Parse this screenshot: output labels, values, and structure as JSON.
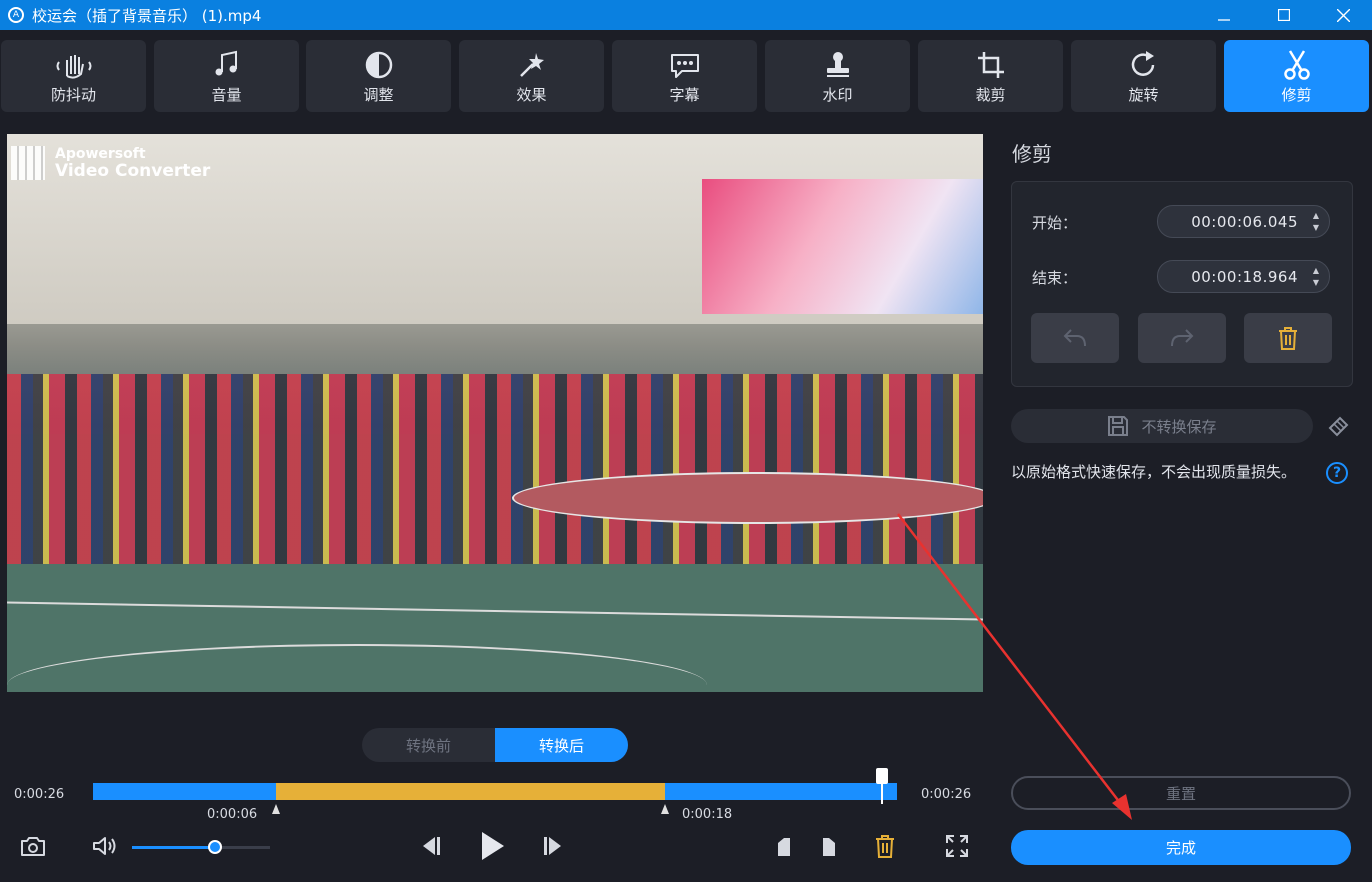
{
  "window": {
    "title": "校运会（插了背景音乐） (1).mp4",
    "app_icon": "app-logo-icon"
  },
  "toolbar": {
    "tools": [
      {
        "label": "防抖动",
        "icon": "stabilize-hand-icon"
      },
      {
        "label": "音量",
        "icon": "music-note-icon"
      },
      {
        "label": "调整",
        "icon": "contrast-circle-icon"
      },
      {
        "label": "效果",
        "icon": "magic-wand-icon"
      },
      {
        "label": "字幕",
        "icon": "speech-bubble-icon"
      },
      {
        "label": "水印",
        "icon": "stamp-icon"
      },
      {
        "label": "裁剪",
        "icon": "crop-icon"
      },
      {
        "label": "旋转",
        "icon": "rotate-icon"
      },
      {
        "label": "修剪",
        "icon": "scissors-icon"
      }
    ],
    "active_index": 8
  },
  "video": {
    "watermark_line1": "Apowersoft",
    "watermark_line2": "Video Converter"
  },
  "preview_toggle": {
    "before": "转换前",
    "after": "转换后",
    "selected": "after"
  },
  "timeline": {
    "current_time": "0:00:26",
    "total_time": "0:00:26",
    "start_marker": "0:00:06",
    "end_marker": "0:00:18",
    "selection_start_fraction": 0.228,
    "selection_end_fraction": 0.712,
    "playhead_fraction": 0.98
  },
  "volume": {
    "level_fraction": 0.6
  },
  "panel": {
    "title": "修剪",
    "start_label": "开始：",
    "start_value": "00:00:06.045",
    "end_label": "结束：",
    "end_value": "00:00:18.964",
    "save_label": "不转换保存",
    "note": "以原始格式快速保存，不会出现质量损失。",
    "help_glyph": "?",
    "reset_label": "重置",
    "done_label": "完成"
  },
  "colors": {
    "accent": "#1a8fff",
    "selection": "#e6b038",
    "titlebar": "#0a80e0",
    "annotation_arrow": "#e8322f"
  }
}
